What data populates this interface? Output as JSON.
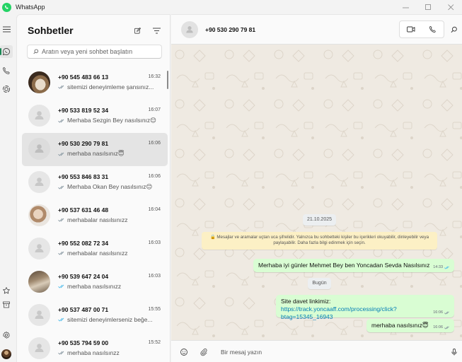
{
  "app": {
    "title": "WhatsApp"
  },
  "sidebar": {
    "heading": "Sohbetler",
    "search_placeholder": "Aratın veya yeni sohbet başlatın"
  },
  "chats": [
    {
      "name": "+90 545 483 66 13",
      "time": "16:32",
      "preview": "sitemizi deneyimleme şansınız...",
      "ticks": "grey",
      "avatar": "photo-dog"
    },
    {
      "name": "+90 533 819 52 34",
      "time": "16:07",
      "preview": "Merhaba Sezgin Bey nasılsınız😊",
      "ticks": "grey",
      "avatar": "default"
    },
    {
      "name": "+90 530 290 79 81",
      "time": "16:06",
      "preview": "merhaba nasılsınız😇",
      "ticks": "grey",
      "avatar": "default",
      "selected": true
    },
    {
      "name": "+90 553 846 83 31",
      "time": "16:06",
      "preview": "Merhaba Okan Bey nasılsınız😊",
      "ticks": "grey",
      "avatar": "default"
    },
    {
      "name": "+90 537 631 46 48",
      "time": "16:04",
      "preview": "merhabalar nasılsınızz",
      "ticks": "grey",
      "avatar": "photo-woman"
    },
    {
      "name": "+90 552 082 72 34",
      "time": "16:03",
      "preview": "merhabalar nasılsınızz",
      "ticks": "grey",
      "avatar": "default"
    },
    {
      "name": "+90 539 647 24 04",
      "time": "16:03",
      "preview": "merhaba nasılsınızz",
      "ticks": "blue",
      "avatar": "photo-group"
    },
    {
      "name": "+90 537 487 00 71",
      "time": "15:55",
      "preview": "sitemizi deneyimlerseniz beğe...",
      "ticks": "blue",
      "avatar": "default"
    },
    {
      "name": "+90 535 794 59 00",
      "time": "15:52",
      "preview": "merhaba nasılsınzz",
      "ticks": "grey",
      "avatar": "default"
    }
  ],
  "conversation": {
    "contact": "+90 530 290 79 81",
    "date_old": "21.10.2025",
    "encryption_notice": "🔒 Mesajlar ve aramalar uçtan uca şifrelidir. Yalnızca bu sohbetteki kişiler bu içerikleri okuyabilir, dinleyebilir veya paylaşabilir. Daha fazla bilgi edinmek için seçin.",
    "date_today": "Bugün",
    "messages": [
      {
        "text": "Merhaba iyi günler Mehmet Bey ben Yoncadan Sevda Nasılsınız",
        "time": "14:33"
      },
      {
        "text": "Site davet linkimiz: ",
        "link": "https://track.yoncaaff.com/processing/click?btag=15345_16943",
        "time": "16:06"
      },
      {
        "text": "merhaba nasılsınız😇",
        "time": "16:06"
      }
    ]
  },
  "composer": {
    "placeholder": "Bir mesaj yazın"
  },
  "colors": {
    "accent": "#25d366",
    "outgoing_bubble": "#d9fdd3",
    "wallpaper": "#efeae2",
    "read_ticks": "#53bdeb"
  }
}
